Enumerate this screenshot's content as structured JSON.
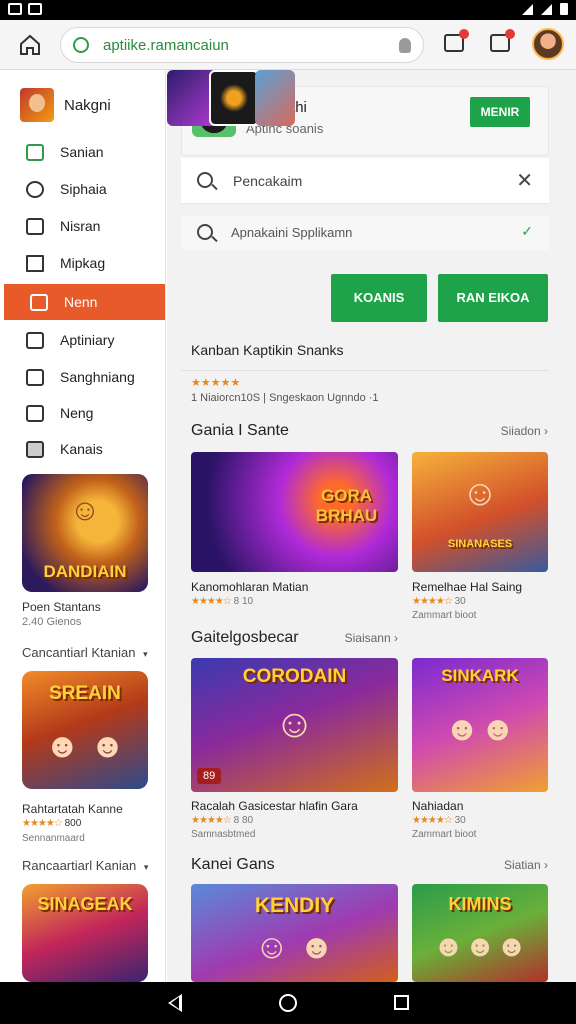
{
  "browser": {
    "url": "aptiike.ramancaiun"
  },
  "sidebar": {
    "profile_name": "Nakgni",
    "items": [
      {
        "label": "Sanian",
        "icon": "download-icon"
      },
      {
        "label": "Siphaia",
        "icon": "gear-icon"
      },
      {
        "label": "Nisran",
        "icon": "inbox-icon"
      },
      {
        "label": "Mipkag",
        "icon": "square-icon"
      },
      {
        "label": "Nenn",
        "icon": "calendar-icon"
      },
      {
        "label": "Aptiniary",
        "icon": "document-icon"
      },
      {
        "label": "Sanghniang",
        "icon": "edit-icon"
      },
      {
        "label": "Neng",
        "icon": "folder-icon"
      },
      {
        "label": "Kanais",
        "icon": "window-icon"
      }
    ],
    "promo": {
      "tile_title": "DANDIAIN",
      "name": "Poen Stantans",
      "sub": "2.40 Gienos"
    },
    "section1": {
      "header": "Cancantiarl Ktanian",
      "tile_title": "SREAIN",
      "name": "Rahtartatah Kanne",
      "rating": "★★★★☆",
      "score": "800",
      "sub": "Sennanmaard"
    },
    "section2": {
      "header": "Rancaartiarl Kanian",
      "tile_title": "SINAGEAK"
    }
  },
  "main": {
    "app_header": {
      "title": "Tantatahi",
      "subtitle": "Aptinc soanis",
      "button": "MENIR"
    },
    "search": {
      "text": "Pencakaim"
    },
    "filter": {
      "text": "Apnakaini Spplikamn"
    },
    "buttons": [
      "KOANIS",
      "RAN EIKOA"
    ],
    "featured_title": "Kanban Kaptikin Snanks",
    "rating": {
      "stars": "★★★★★",
      "meta": "1 Niaiorcn10S  |  Sngeskaon Ugnndo ·1"
    },
    "sections": [
      {
        "title": "Gania I Sante",
        "link": "Siiadon",
        "games": [
          {
            "tile_title": "GORA BRHAU",
            "name": "Kanomohlaran Matian",
            "rating": "★★★★☆",
            "score": "8 10",
            "meta": ""
          },
          {
            "tile_title": "SINANASES",
            "name": "Remelhae Hal Saing",
            "rating": "★★★★☆",
            "score": "30",
            "meta": "Zammart bioot"
          }
        ]
      },
      {
        "title": "Gaitelgosbecar",
        "link": "Siaisann",
        "games": [
          {
            "tile_title": "CORODAIN",
            "name": "Racalah Gasicestar hlafin Gara",
            "rating": "★★★★☆",
            "score": "8 80",
            "meta": "Samnasbtmed",
            "badge": "89"
          },
          {
            "tile_title": "SINKARK",
            "name": "Nahiadan",
            "rating": "★★★★☆",
            "score": "30",
            "meta": "Zammart bioot"
          }
        ]
      },
      {
        "title": "Kanei Gans",
        "link": "Siatian",
        "games": [
          {
            "tile_title": "KENDIY"
          },
          {
            "tile_title": "KIMINS"
          }
        ]
      }
    ]
  }
}
